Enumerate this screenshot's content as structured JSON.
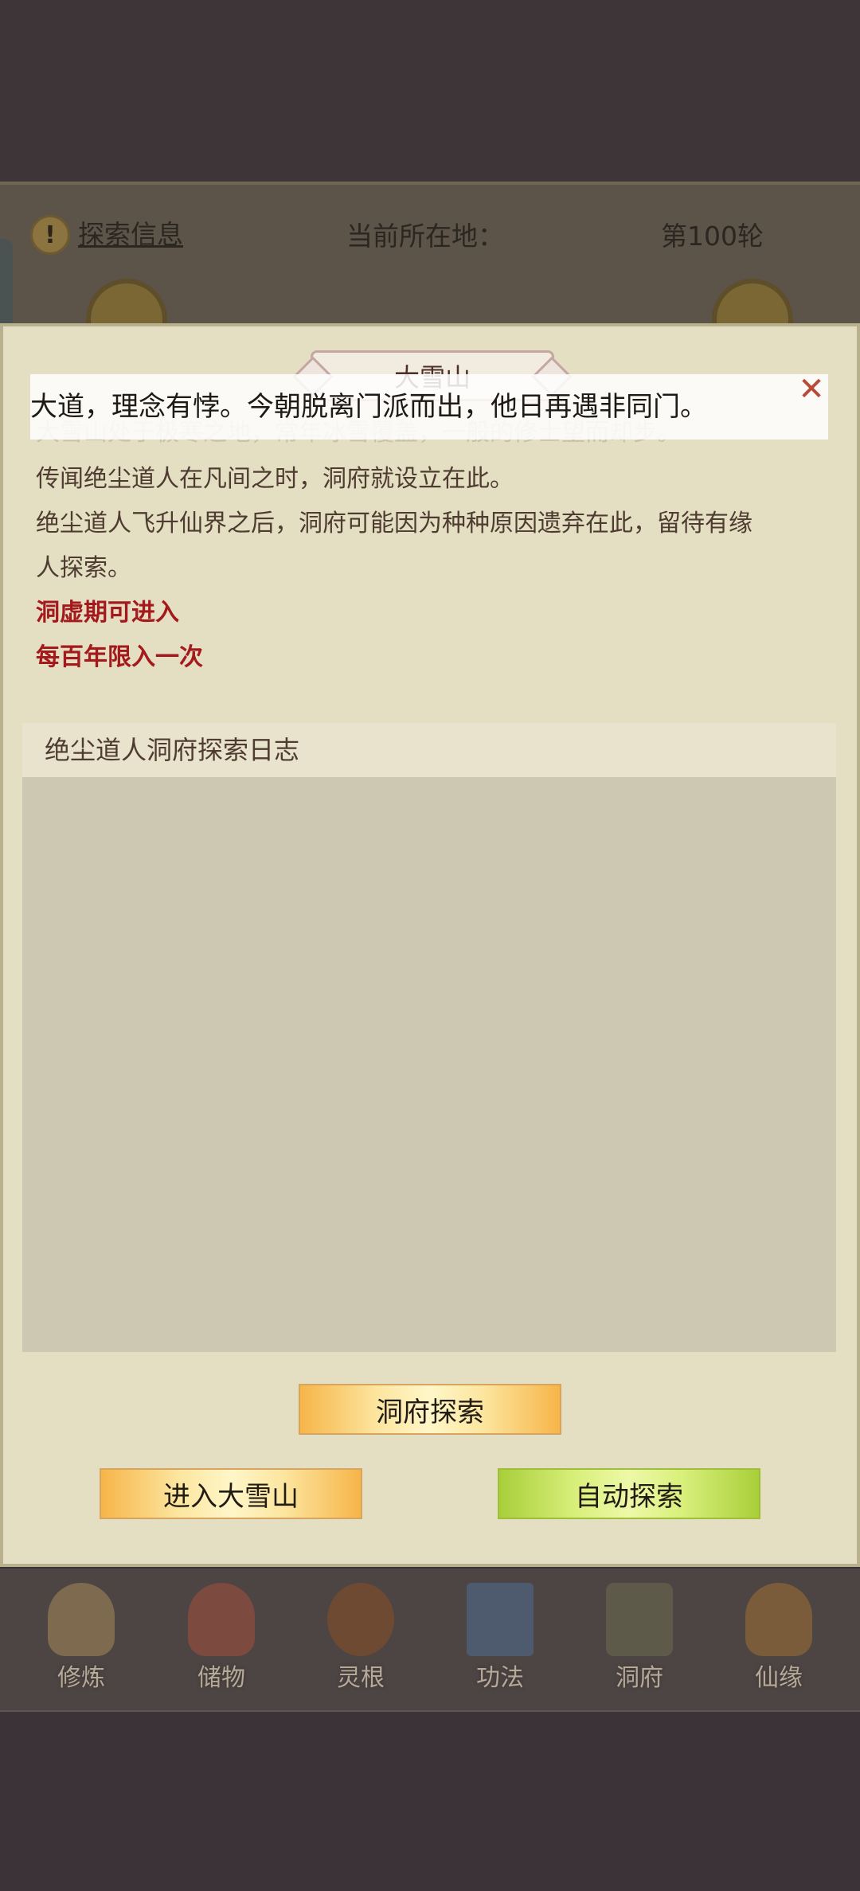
{
  "info_bar": {
    "alert_icon": "!",
    "link": "探索信息",
    "location": "当前所在地：",
    "round": "第100轮"
  },
  "dialog": {
    "title": "大雪山",
    "close_icon": "✕",
    "toast": "大道，理念有悖。今朝脱离门派而出，他日再遇非同门。",
    "description": [
      "大雪山处于极寒之地，常年冰雪覆盖，一般的修士望而却步。",
      "传闻绝尘道人在凡间之时，洞府就设立在此。",
      "绝尘道人飞升仙界之后，洞府可能因为种种原因遗弃在此，留待有缘",
      "人探索。"
    ],
    "requirements": [
      "洞虚期可进入",
      "每百年限入一次"
    ],
    "log_title": "绝尘道人洞府探索日志",
    "buttons": {
      "explore": "洞府探索",
      "enter": "进入大雪山",
      "auto": "自动探索"
    }
  },
  "nav": {
    "items": [
      {
        "label": "修炼",
        "icon": "cultivator-icon"
      },
      {
        "label": "储物",
        "icon": "storage-bag-icon"
      },
      {
        "label": "灵根",
        "icon": "spirit-root-icon"
      },
      {
        "label": "功法",
        "icon": "technique-book-icon"
      },
      {
        "label": "洞府",
        "icon": "cave-dwelling-icon"
      },
      {
        "label": "仙缘",
        "icon": "gourd-icon"
      }
    ]
  },
  "colors": {
    "panel_bg": "#e4dec3",
    "accent_red": "#a4191c",
    "gold_button": "#f7b549",
    "green_button": "#a8cf3a"
  }
}
